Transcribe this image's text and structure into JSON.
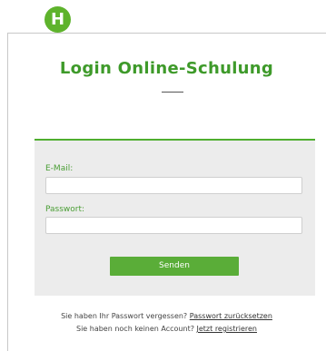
{
  "step_badge": "H",
  "page": {
    "title": "Login Online-Schulung"
  },
  "form": {
    "email_label": "E-Mail:",
    "email_value": "",
    "password_label": "Passwort:",
    "password_value": "",
    "submit_label": "Senden"
  },
  "footer": {
    "forgot_text": "Sie haben Ihr Passwort vergessen?",
    "forgot_link": "Passwort zurücksetzen",
    "register_text": "Sie haben noch keinen Account?",
    "register_link": "Jetzt registrieren"
  },
  "colors": {
    "accent_green": "#5eb32c",
    "title_green": "#3e9a2a",
    "panel_background": "#ececec"
  }
}
